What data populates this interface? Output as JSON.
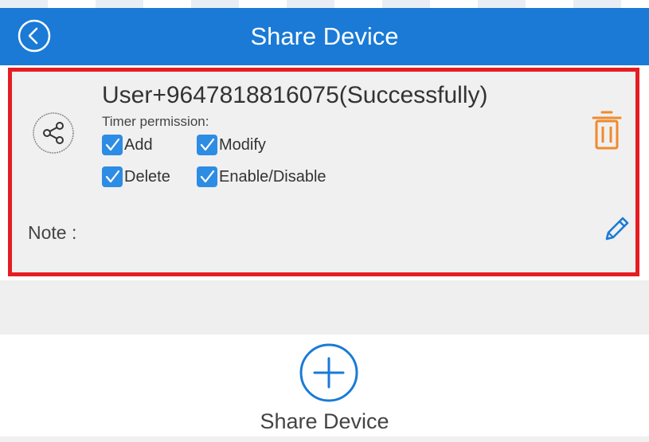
{
  "header": {
    "title": "Share Device",
    "back_icon": "chevron-left-circle-icon",
    "background": "#1a7ad6"
  },
  "share_entry": {
    "user": "User+9647818816075(Successfully)",
    "timer_permission_label": "Timer permission:",
    "permissions": [
      {
        "label": "Add",
        "checked": true
      },
      {
        "label": "Modify",
        "checked": true
      },
      {
        "label": "Delete",
        "checked": true
      },
      {
        "label": "Enable/Disable",
        "checked": true
      }
    ],
    "note_label": "Note :",
    "share_icon": "share-icon",
    "delete_icon": "trash-icon",
    "edit_icon": "pencil-icon",
    "highlight_color": "#e51d22",
    "delete_color": "#f08a2c",
    "accent": "#2d8ce4"
  },
  "add_share": {
    "label": "Share Device",
    "icon": "plus-circle-icon"
  }
}
